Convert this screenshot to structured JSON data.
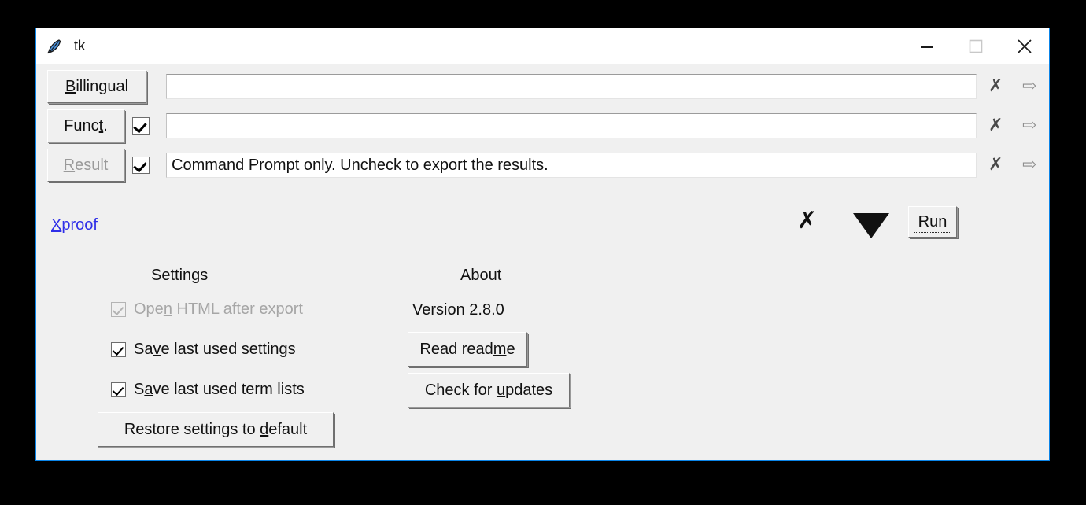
{
  "window": {
    "title": "tk",
    "icon": "feather-icon",
    "accent_border": "#0a84e8",
    "titlebar_bg": "#ffffff",
    "client_bg": "#f0f0f0",
    "controls": {
      "minimize": "minimize-icon",
      "maximize": "maximize-icon",
      "close": "close-icon"
    }
  },
  "rows": [
    {
      "button_label": "Billingual",
      "button_mnemonic": "B",
      "button_disabled": false,
      "has_checkbox": false,
      "checkbox_checked": false,
      "entry_value": "",
      "entry_placeholder": "",
      "clear_icon": "✗",
      "send_icon": "⇨"
    },
    {
      "button_label": "Funct.",
      "button_mnemonic": "t",
      "button_disabled": false,
      "has_checkbox": true,
      "checkbox_checked": true,
      "entry_value": "",
      "entry_placeholder": "",
      "clear_icon": "✗",
      "send_icon": "⇨"
    },
    {
      "button_label": "Result",
      "button_mnemonic": "R",
      "button_disabled": true,
      "has_checkbox": true,
      "checkbox_checked": true,
      "entry_value": "Command Prompt only. Uncheck to export the results.",
      "entry_placeholder": "",
      "clear_icon": "✗",
      "send_icon": "⇨"
    }
  ],
  "action_bar": {
    "link_label": "Xproof",
    "link_mnemonic": "X",
    "link_color": "#2f2fe8",
    "clear_all_icon": "✗",
    "dropdown_icon": "▼",
    "run_label": "Run",
    "run_focused": true
  },
  "settings": {
    "heading": "Settings",
    "options": [
      {
        "label_pre": "Ope",
        "mnemonic": "n",
        "label_post": " HTML after export",
        "checked": true,
        "disabled": true
      },
      {
        "label_pre": "Sa",
        "mnemonic": "v",
        "label_post": "e last used settings",
        "checked": true,
        "disabled": false
      },
      {
        "label_pre": "S",
        "mnemonic": "a",
        "label_post": "ve last used term lists",
        "checked": true,
        "disabled": false
      }
    ],
    "restore_button": {
      "label_pre": "Restore settings to ",
      "mnemonic": "d",
      "label_post": "efault"
    }
  },
  "about": {
    "heading": "About",
    "version": "Version 2.8.0",
    "buttons": [
      {
        "label_pre": "Read read",
        "mnemonic": "m",
        "label_post": "e"
      },
      {
        "label_pre": "Check for ",
        "mnemonic": "u",
        "label_post": "pdates"
      }
    ]
  }
}
